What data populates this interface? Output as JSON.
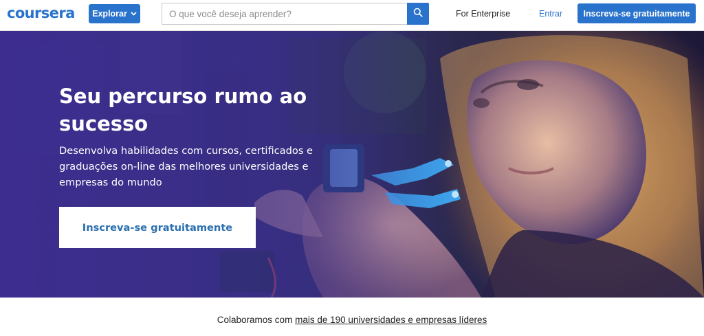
{
  "header": {
    "logo_text": "coursera",
    "explore_label": "Explorar",
    "search": {
      "placeholder": "O que você deseja aprender?",
      "value": ""
    },
    "enterprise_label": "For Enterprise",
    "signin_label": "Entrar",
    "signup_label": "Inscreva-se gratuitamente"
  },
  "hero": {
    "title": "Seu percurso rumo ao sucesso",
    "subtitle": "Desenvolva habilidades com cursos, certificados e graduações on-line das melhores universidades e empresas do mundo",
    "cta_label": "Inscreva-se gratuitamente"
  },
  "partners": {
    "text": "Colaboramos com",
    "link_text": "mais de 190 universidades e empresas líderes"
  },
  "colors": {
    "brand_blue": "#2a73cc",
    "hero_purple": "#3a2c86",
    "cta_text": "#2b6fb0"
  },
  "icons": {
    "explore_chevron": "chevron-down-icon",
    "search": "search-icon"
  }
}
